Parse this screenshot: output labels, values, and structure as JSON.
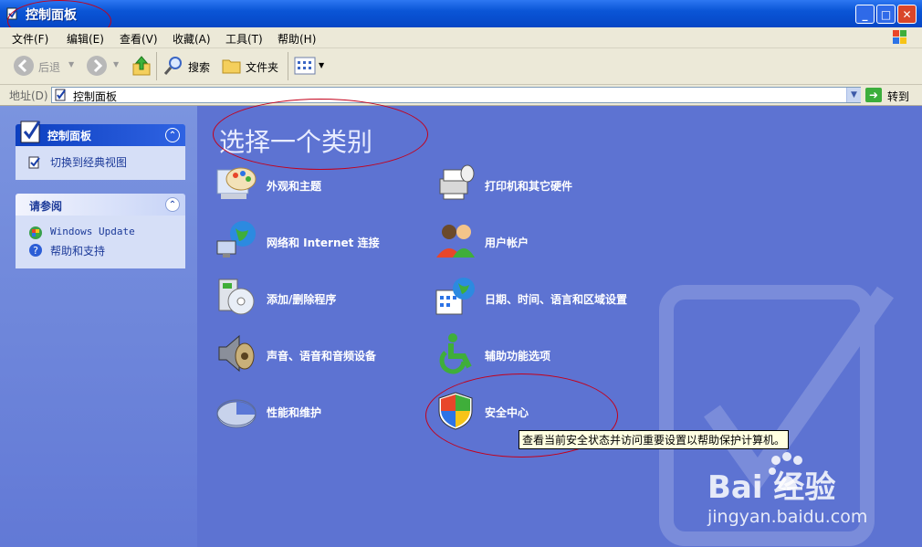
{
  "window": {
    "title": "控制面板"
  },
  "menu": [
    "文件(F)",
    "编辑(E)",
    "查看(V)",
    "收藏(A)",
    "工具(T)",
    "帮助(H)"
  ],
  "toolbar": {
    "back": "后退",
    "search": "搜索",
    "folders": "文件夹"
  },
  "address": {
    "label": "地址(D)",
    "value": "控制面板",
    "go": "转到"
  },
  "left_panel": {
    "control_panel_title": "控制面板",
    "switch_view": "切换到经典视图",
    "see_also_title": "请参阅",
    "see_also": [
      "Windows Update",
      "帮助和支持"
    ]
  },
  "main": {
    "heading": "选择一个类别",
    "categories": [
      {
        "label": "外观和主题",
        "icon": "appearance-icon"
      },
      {
        "label": "打印机和其它硬件",
        "icon": "printer-icon"
      },
      {
        "label": "网络和 Internet 连接",
        "icon": "network-icon"
      },
      {
        "label": "用户帐户",
        "icon": "users-icon"
      },
      {
        "label": "添加/删除程序",
        "icon": "add-remove-icon"
      },
      {
        "label": "日期、时间、语言和区域设置",
        "icon": "date-time-icon"
      },
      {
        "label": "声音、语音和音频设备",
        "icon": "sound-icon"
      },
      {
        "label": "辅助功能选项",
        "icon": "accessibility-icon"
      },
      {
        "label": "性能和维护",
        "icon": "performance-icon"
      },
      {
        "label": "安全中心",
        "icon": "security-shield-icon"
      }
    ],
    "tooltip": "查看当前安全状态并访问重要设置以帮助保护计算机。"
  },
  "watermark": {
    "brand": "Bai  经验",
    "url": "jingyan.baidu.com"
  }
}
